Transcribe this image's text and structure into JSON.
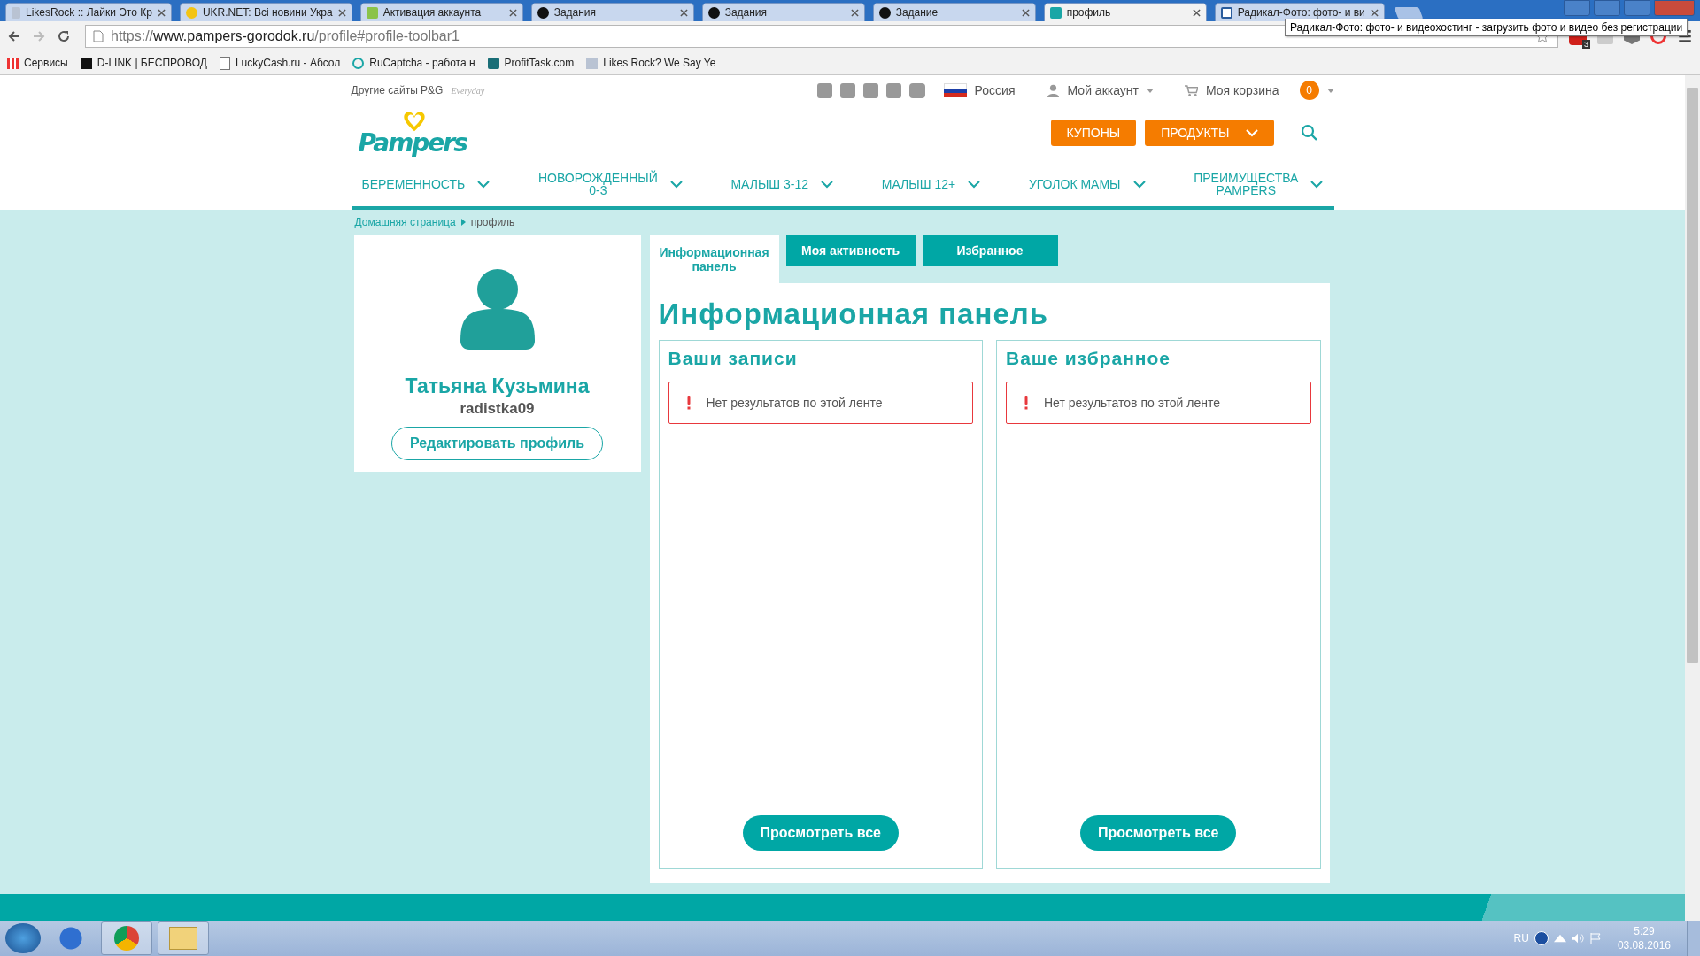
{
  "browser": {
    "tabs": [
      {
        "title": "LikesRock :: Лайки Это Кр",
        "selected": false
      },
      {
        "title": "UKR.NET: Всі новини Укра",
        "selected": false
      },
      {
        "title": "Активация аккаунта",
        "selected": false
      },
      {
        "title": "Задания",
        "selected": false
      },
      {
        "title": "Задания",
        "selected": false
      },
      {
        "title": "Задание",
        "selected": false
      },
      {
        "title": "профиль",
        "selected": true
      },
      {
        "title": "Радикал-Фото: фото- и ви",
        "selected": false
      }
    ],
    "tooltip": "Радикал-Фото: фото- и видеохостинг - загрузить фото и видео без регистрации",
    "url": {
      "scheme": "https://",
      "host": "www.pampers-gorodok.ru",
      "path": "/profile#profile-toolbar1"
    },
    "adblock_count": "3",
    "bookmarks": [
      "Сервисы",
      "D-LINK | БЕСПРОВОД",
      "LuckyCash.ru - Абсол",
      "RuCaptcha - работа н",
      "ProfitTask.com",
      "Likes Rock? We Say Ye"
    ]
  },
  "header": {
    "other_sites": "Другие сайты P&G",
    "everyday": "Everyday",
    "region": "Россия",
    "account": "Мой аккаунт",
    "cart": "Моя корзина",
    "cart_count": "0",
    "logo": "Pampers",
    "buttons": [
      {
        "label": "КУПОНЫ",
        "caret": false
      },
      {
        "label": "ПРОДУКТЫ",
        "caret": true
      }
    ],
    "nav": [
      "БЕРЕМЕННОСТЬ",
      "НОВОРОЖДЕННЫЙ\n0-3",
      "МАЛЫШ 3-12",
      "МАЛЫШ 12+",
      "УГОЛОК МАМЫ",
      "ПРЕИМУЩЕСТВА\nPAMPERS"
    ]
  },
  "breadcrumb": [
    "Домашняя страница",
    "профиль"
  ],
  "profile": {
    "name": "Татьяна Кузьмина",
    "username": "radistka09",
    "edit_button": "Редактировать профиль"
  },
  "tabs": [
    {
      "label": "Информационная\nпанель",
      "selected": true
    },
    {
      "label": "Моя активность",
      "selected": false
    },
    {
      "label": "Избранное",
      "selected": false
    }
  ],
  "heading": "Информационная панель",
  "cards": [
    {
      "title": "Ваши записи",
      "alert": "Нет результатов по этой ленте",
      "button": "Просмотреть все"
    },
    {
      "title": "Ваше избранное",
      "alert": "Нет результатов по этой ленте",
      "button": "Просмотреть все"
    }
  ],
  "taskbar": {
    "language": "RU",
    "time": "5:29",
    "date": "03.08.2016"
  }
}
